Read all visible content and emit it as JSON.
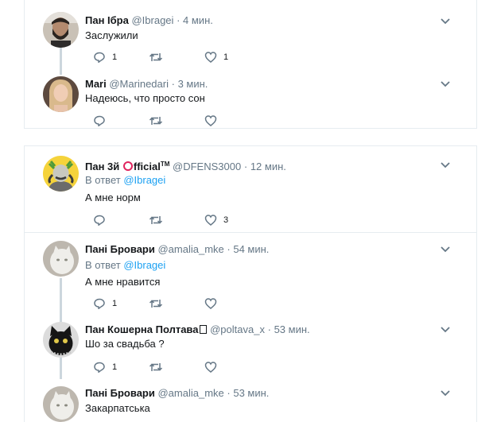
{
  "card1": {
    "tweets": [
      {
        "name": "Пан Ібра",
        "handle": "@Ibragei",
        "time": "4 мин.",
        "text": "Заслужили",
        "replies": "1",
        "retweets": "",
        "likes": "1",
        "avatar_icon": "avatar-bearded-man"
      },
      {
        "name": "Mari",
        "handle": "@Marinedari",
        "time": "3 мин.",
        "text": "Надеюсь, что просто сон",
        "replies": "",
        "retweets": "",
        "likes": "",
        "avatar_icon": "avatar-blonde-woman"
      }
    ]
  },
  "card2": {
    "tweets": [
      {
        "name_prefix": "Пан 3й ",
        "name_suffix": "fficial",
        "tm": "TM",
        "handle": "@DFENS3000",
        "time": "12 мин.",
        "reply_label": "В ответ",
        "reply_mention": "@Ibragei",
        "text": "А мне норм",
        "replies": "",
        "retweets": "",
        "likes": "3",
        "avatar_icon": "avatar-cartoon-cossack"
      },
      {
        "name": "Пані Бровари",
        "handle": "@amalia_mke",
        "time": "54 мин.",
        "reply_label": "В ответ",
        "reply_mention": "@Ibragei",
        "text": "А мне нравится",
        "replies": "1",
        "retweets": "",
        "likes": "",
        "avatar_icon": "avatar-white-cat"
      },
      {
        "name": "Пан Кошерна Полтава",
        "handle": "@poltava_x",
        "time": "53 мин.",
        "text": "Шо за свадьба ?",
        "replies": "1",
        "retweets": "",
        "likes": "",
        "avatar_icon": "avatar-black-cat"
      },
      {
        "name": "Пані Бровари",
        "handle": "@amalia_mke",
        "time": "53 мин.",
        "text": "Закарпатська",
        "avatar_icon": "avatar-white-cat"
      }
    ]
  },
  "ui": {
    "dot": "·",
    "accent_color": "#1da1f2",
    "icon_color": "#657786",
    "thread_line_color": "#ccd6dd"
  }
}
